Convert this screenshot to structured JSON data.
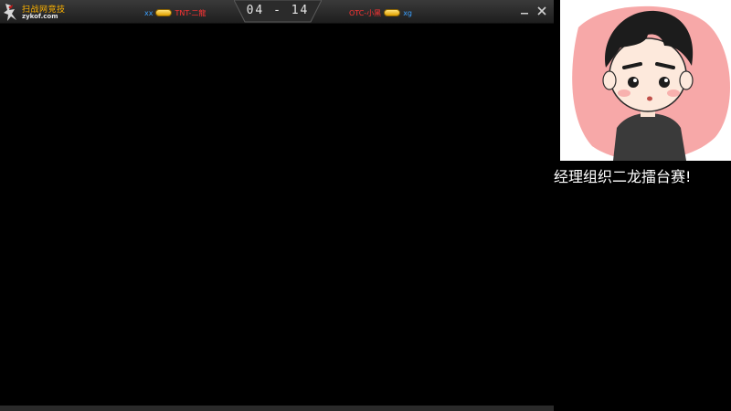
{
  "client": {
    "brand": {
      "name": "扫战网竞技",
      "domain": "zykof.com"
    },
    "score": "04 - 14",
    "left_player": {
      "tag": "xx",
      "name": "TNT-二龍",
      "tag_color": "#3aa0ff",
      "name_color": "#ff3333"
    },
    "right_player": {
      "tag": "OTC-小黑",
      "name": "xg",
      "tag_color": "#ff3333",
      "name_color": "#3aa0ff"
    },
    "buttons": {
      "minimize_icon": "minimize-icon",
      "close_icon": "close-icon"
    }
  },
  "side_panel": {
    "avatar": "cartoon-man-avatar",
    "caption": "经理组织二龙擂台赛!"
  },
  "colors": {
    "badge_gold": "#f0b000",
    "avatar_bg": "#f7a8a8"
  }
}
